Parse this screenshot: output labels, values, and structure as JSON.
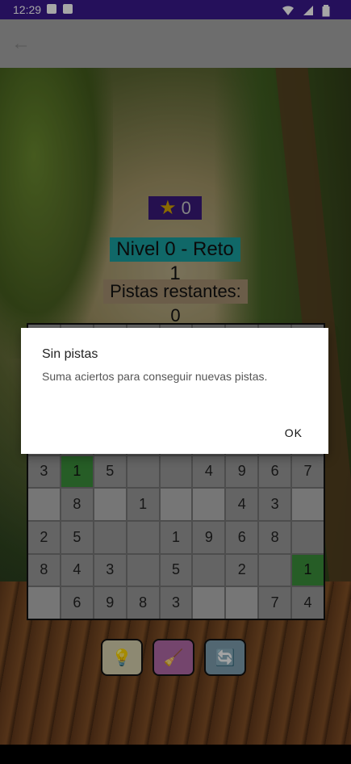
{
  "status_bar": {
    "time": "12:29",
    "icons_left": [
      "text-icon",
      "sd-card-icon"
    ],
    "icons_right": [
      "wifi-icon",
      "signal-icon",
      "battery-icon"
    ]
  },
  "toolbar": {
    "back_icon": "arrow-back-icon"
  },
  "game": {
    "score": "0",
    "level": "Nivel 0 - Reto 1",
    "hints_left": "Pistas restantes: 0"
  },
  "grid": {
    "rows": [
      [
        "",
        "",
        "",
        "",
        "",
        "",
        "",
        "",
        ""
      ],
      [
        "",
        "",
        "",
        "",
        "",
        "",
        "",
        "",
        ""
      ],
      [
        "",
        "",
        "",
        "",
        "",
        "",
        "",
        "",
        ""
      ],
      [
        "",
        "",
        "",
        "",
        "",
        "",
        "",
        "",
        ""
      ],
      [
        "3",
        "1",
        "5",
        "",
        "",
        "4",
        "9",
        "6",
        "7"
      ],
      [
        "",
        "8",
        "",
        "1",
        "",
        "",
        "4",
        "3",
        ""
      ],
      [
        "2",
        "5",
        "",
        "",
        "1",
        "9",
        "6",
        "8",
        ""
      ],
      [
        "8",
        "4",
        "3",
        "",
        "5",
        "",
        "2",
        "",
        "1"
      ],
      [
        "",
        "6",
        "9",
        "8",
        "3",
        "",
        "",
        "7",
        "4"
      ]
    ]
  },
  "buttons": {
    "hint_icon": "lightbulb-icon",
    "clear_icon": "broom-icon",
    "reset_icon": "refresh-icon"
  },
  "dialog": {
    "title": "Sin pistas",
    "message": "Suma aciertos para conseguir nuevas pistas.",
    "ok_label": "OK"
  }
}
